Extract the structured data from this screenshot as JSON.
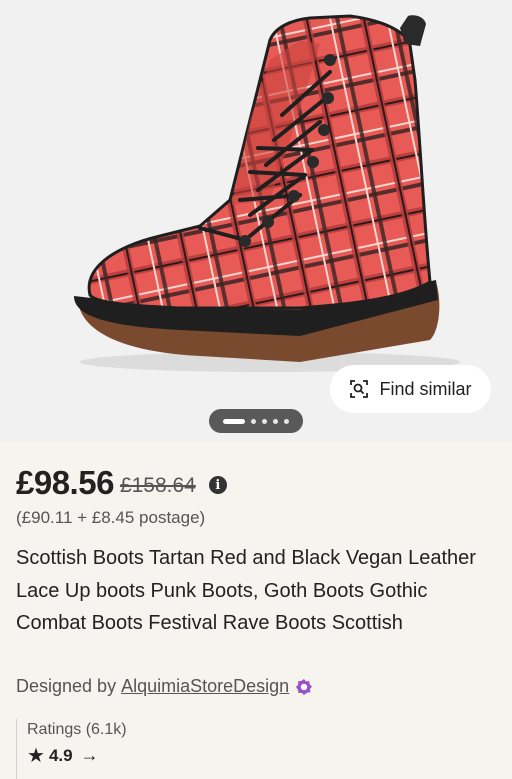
{
  "product": {
    "image_alt": "Red tartan vegan leather lace up boot",
    "find_similar": "Find similar",
    "carousel": {
      "count": 5,
      "active": 0
    },
    "price": "£98.56",
    "original_price": "£158.64",
    "info_icon": "i",
    "postage": "(£90.11 + £8.45 postage)",
    "title": "Scottish Boots Tartan Red and Black Vegan Leather Lace Up boots Punk Boots, Goth Boots Gothic Combat Boots Festival Rave Boots Scottish",
    "designed_by_label": "Designed by",
    "shop_name": "AlquimiaStoreDesign",
    "ratings_label": "Ratings (6.1k)",
    "rating": "4.9"
  },
  "icons": {
    "find_similar": "visual-search-icon",
    "info": "info-icon",
    "badge": "star-seller-badge-icon",
    "star": "star-icon",
    "arrow": "arrow-right-icon"
  },
  "colors": {
    "boot_red": "#e85a55",
    "tartan_dark": "#2a1a1a",
    "sole_brown": "#7a4a2e",
    "badge_purple": "#9b4fc9"
  }
}
